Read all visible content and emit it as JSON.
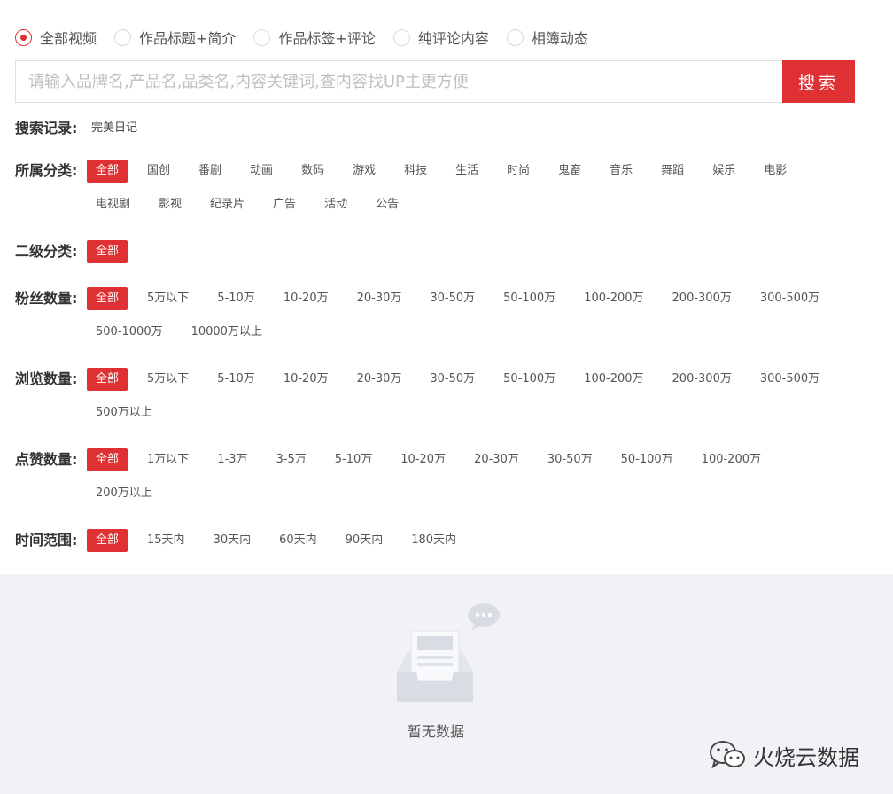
{
  "scope": {
    "options": [
      "全部视频",
      "作品标题+简介",
      "作品标签+评论",
      "纯评论内容",
      "相簿动态"
    ],
    "selected_index": 0
  },
  "search": {
    "placeholder": "请输入品牌名,产品名,品类名,内容关键词,查内容找UP主更方便",
    "button": "搜索"
  },
  "history": {
    "label": "搜索记录:",
    "items": [
      "完美日记"
    ]
  },
  "category": {
    "label": "所属分类:",
    "items": [
      "全部",
      "国创",
      "番剧",
      "动画",
      "数码",
      "游戏",
      "科技",
      "生活",
      "时尚",
      "鬼畜",
      "音乐",
      "舞蹈",
      "娱乐",
      "电影",
      "电视剧",
      "影视",
      "纪录片",
      "广告",
      "活动",
      "公告"
    ]
  },
  "subcategory": {
    "label": "二级分类:",
    "items": [
      "全部"
    ]
  },
  "fans": {
    "label": "粉丝数量:",
    "items": [
      "全部",
      "5万以下",
      "5-10万",
      "10-20万",
      "20-30万",
      "30-50万",
      "50-100万",
      "100-200万",
      "200-300万",
      "300-500万",
      "500-1000万",
      "10000万以上"
    ]
  },
  "views": {
    "label": "浏览数量:",
    "items": [
      "全部",
      "5万以下",
      "5-10万",
      "10-20万",
      "20-30万",
      "30-50万",
      "50-100万",
      "100-200万",
      "200-300万",
      "300-500万",
      "500万以上"
    ]
  },
  "likes": {
    "label": "点赞数量:",
    "items": [
      "全部",
      "1万以下",
      "1-3万",
      "3-5万",
      "5-10万",
      "10-20万",
      "20-30万",
      "30-50万",
      "50-100万",
      "100-200万",
      "200万以上"
    ]
  },
  "time": {
    "label": "时间范围:",
    "items": [
      "全部",
      "15天内",
      "30天内",
      "60天内",
      "90天内",
      "180天内"
    ]
  },
  "empty": {
    "text": "暂无数据"
  },
  "watermark": {
    "text": "火烧云数据"
  },
  "colors": {
    "accent": "#df3033",
    "empty_bg": "#f0f2f5"
  }
}
